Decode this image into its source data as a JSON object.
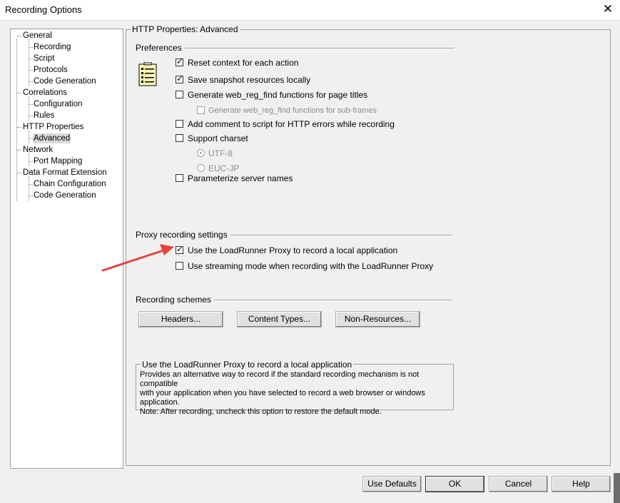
{
  "window": {
    "title": "Recording Options"
  },
  "tree": [
    {
      "label": "General",
      "level": 0
    },
    {
      "label": "Recording",
      "level": 1
    },
    {
      "label": "Script",
      "level": 1
    },
    {
      "label": "Protocols",
      "level": 1
    },
    {
      "label": "Code Generation",
      "level": 1
    },
    {
      "label": "Correlations",
      "level": 0
    },
    {
      "label": "Configuration",
      "level": 1
    },
    {
      "label": "Rules",
      "level": 1
    },
    {
      "label": "HTTP Properties",
      "level": 0
    },
    {
      "label": "Advanced",
      "level": 1,
      "selected": true
    },
    {
      "label": "Network",
      "level": 0
    },
    {
      "label": "Port Mapping",
      "level": 1
    },
    {
      "label": "Data Format Extension",
      "level": 0
    },
    {
      "label": "Chain Configuration",
      "level": 1
    },
    {
      "label": "Code Generation",
      "level": 1
    }
  ],
  "main": {
    "title": "HTTP Properties: Advanced",
    "preferences": {
      "label": "Preferences",
      "reset_context": {
        "label": "Reset context for each action",
        "checked": true
      },
      "save_snapshot": {
        "label": "Save snapshot resources locally",
        "checked": true
      },
      "generate_web_reg_find": {
        "label": "Generate web_reg_find functions for page titles",
        "checked": false
      },
      "generate_sub_frames": {
        "label": "Generate web_reg_find functions for sub-frames",
        "checked": false,
        "disabled": true
      },
      "add_comment": {
        "label": "Add comment to script for HTTP errors while recording",
        "checked": false
      },
      "support_charset": {
        "label": "Support charset",
        "checked": false
      },
      "utf8": {
        "label": "UTF-8",
        "selected": true,
        "disabled": true
      },
      "eucjp": {
        "label": "EUC-JP",
        "selected": false,
        "disabled": true
      },
      "parameterize": {
        "label": "Parameterize server names",
        "checked": false
      }
    },
    "proxy": {
      "label": "Proxy recording settings",
      "use_proxy": {
        "label": "Use the LoadRunner Proxy to record a local application",
        "checked": true
      },
      "streaming": {
        "label": "Use streaming mode when recording with the LoadRunner Proxy",
        "checked": false
      }
    },
    "schemes": {
      "label": "Recording schemes",
      "headers": "Headers...",
      "content_types": "Content Types...",
      "non_resources": "Non-Resources..."
    },
    "info": {
      "title": "Use the LoadRunner Proxy to record a local application",
      "text": "Provides an alternative way to record if the standard recording mechanism is not compatible\nwith your application when you have selected to record a web browser or windows\napplication.\nNote:  After recording, uncheck this option to restore the default mode."
    }
  },
  "footer": {
    "use_defaults": "Use Defaults",
    "ok": "OK",
    "cancel": "Cancel",
    "help": "Help"
  },
  "colors": {
    "arrow": "#e8413c"
  }
}
